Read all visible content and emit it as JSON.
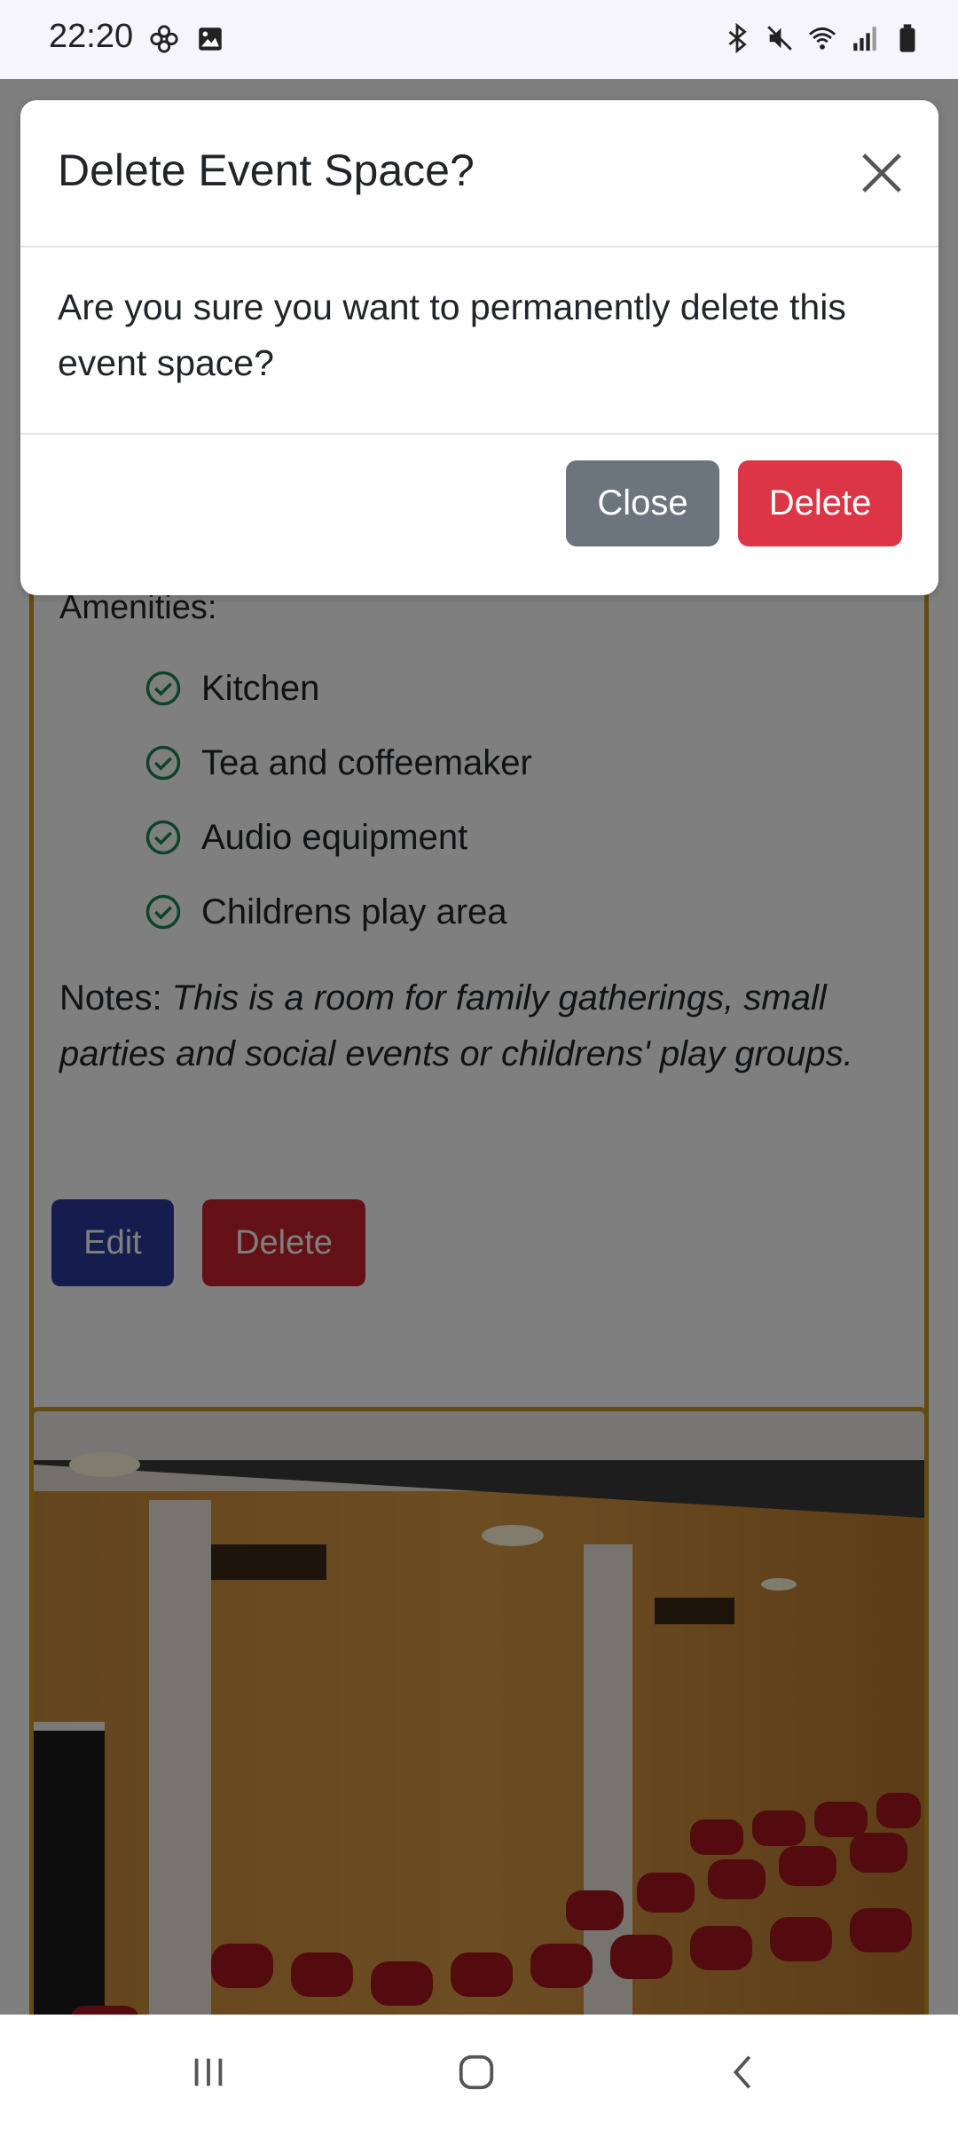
{
  "status_bar": {
    "time": "22:20",
    "left_icons": [
      "flower-icon",
      "image-icon"
    ],
    "right_icons": [
      "bluetooth-icon",
      "mute-icon",
      "wifi-icon",
      "signal-icon",
      "battery-icon"
    ]
  },
  "modal": {
    "title": "Delete Event Space?",
    "body": "Are you sure you want to permanently delete this event space?",
    "close_label": "Close",
    "delete_label": "Delete"
  },
  "card": {
    "amenities_label": "Amenities:",
    "amenities": [
      "Kitchen",
      "Tea and coffeemaker",
      "Audio equipment",
      "Childrens play area"
    ],
    "notes_label": "Notes: ",
    "notes_text": "This is a room for family gatherings, small parties and social events or childrens' play groups.",
    "edit_label": "Edit",
    "delete_label": "Delete"
  },
  "colors": {
    "border_gold": "#c8961e",
    "edit_blue": "#2a3a9e",
    "delete_red": "#dc3545",
    "close_gray": "#6c757d",
    "check_green": "#198754"
  },
  "nav_bar": {
    "icons": [
      "recent-apps-icon",
      "home-icon",
      "back-icon"
    ]
  }
}
